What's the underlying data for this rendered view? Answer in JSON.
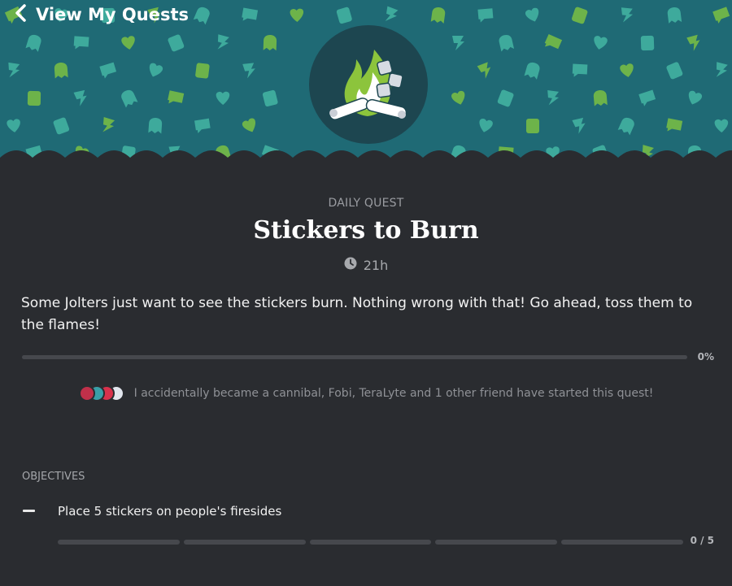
{
  "header": {
    "back_label": "View My Quests",
    "banner_color": "#1f6a75",
    "pattern_color": "#44b5a3",
    "pattern_accent": "#7bc043"
  },
  "quest": {
    "kicker": "DAILY QUEST",
    "title": "Stickers to Burn",
    "time_left": "21h",
    "description": "Some Jolters just want to see the stickers burn. Nothing wrong with that! Go ahead, toss them to the flames!",
    "progress": {
      "value": 0,
      "label": "0%"
    },
    "accent": "#7bc043"
  },
  "friends": {
    "text": "I accidentally became a cannibal, Fobi, TeraLyte and 1 other friend have started this quest!",
    "avatar_colors": [
      "#c0304a",
      "#3a9fa8",
      "#d8314c",
      "#e2e6ee"
    ]
  },
  "objectives": {
    "heading": "OBJECTIVES",
    "items": [
      {
        "label": "Place 5 stickers on people's firesides",
        "done": 0,
        "total": 5,
        "count_label": "0 / 5"
      }
    ]
  }
}
